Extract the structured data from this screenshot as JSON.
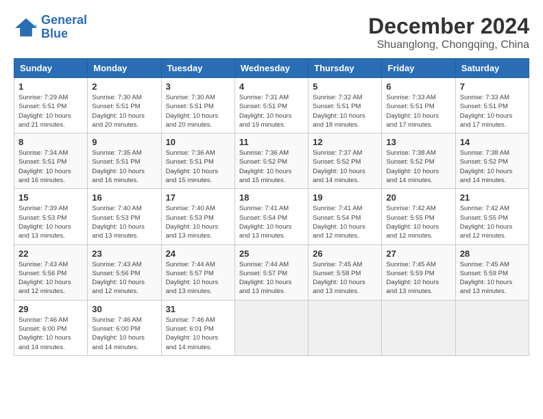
{
  "logo": {
    "line1": "General",
    "line2": "Blue"
  },
  "title": "December 2024",
  "subtitle": "Shuanglong, Chongqing, China",
  "weekdays": [
    "Sunday",
    "Monday",
    "Tuesday",
    "Wednesday",
    "Thursday",
    "Friday",
    "Saturday"
  ],
  "weeks": [
    [
      {
        "day": "1",
        "info": "Sunrise: 7:29 AM\nSunset: 5:51 PM\nDaylight: 10 hours\nand 21 minutes."
      },
      {
        "day": "2",
        "info": "Sunrise: 7:30 AM\nSunset: 5:51 PM\nDaylight: 10 hours\nand 20 minutes."
      },
      {
        "day": "3",
        "info": "Sunrise: 7:30 AM\nSunset: 5:51 PM\nDaylight: 10 hours\nand 20 minutes."
      },
      {
        "day": "4",
        "info": "Sunrise: 7:31 AM\nSunset: 5:51 PM\nDaylight: 10 hours\nand 19 minutes."
      },
      {
        "day": "5",
        "info": "Sunrise: 7:32 AM\nSunset: 5:51 PM\nDaylight: 10 hours\nand 18 minutes."
      },
      {
        "day": "6",
        "info": "Sunrise: 7:33 AM\nSunset: 5:51 PM\nDaylight: 10 hours\nand 17 minutes."
      },
      {
        "day": "7",
        "info": "Sunrise: 7:33 AM\nSunset: 5:51 PM\nDaylight: 10 hours\nand 17 minutes."
      }
    ],
    [
      {
        "day": "8",
        "info": "Sunrise: 7:34 AM\nSunset: 5:51 PM\nDaylight: 10 hours\nand 16 minutes."
      },
      {
        "day": "9",
        "info": "Sunrise: 7:35 AM\nSunset: 5:51 PM\nDaylight: 10 hours\nand 16 minutes."
      },
      {
        "day": "10",
        "info": "Sunrise: 7:36 AM\nSunset: 5:51 PM\nDaylight: 10 hours\nand 15 minutes."
      },
      {
        "day": "11",
        "info": "Sunrise: 7:36 AM\nSunset: 5:52 PM\nDaylight: 10 hours\nand 15 minutes."
      },
      {
        "day": "12",
        "info": "Sunrise: 7:37 AM\nSunset: 5:52 PM\nDaylight: 10 hours\nand 14 minutes."
      },
      {
        "day": "13",
        "info": "Sunrise: 7:38 AM\nSunset: 5:52 PM\nDaylight: 10 hours\nand 14 minutes."
      },
      {
        "day": "14",
        "info": "Sunrise: 7:38 AM\nSunset: 5:52 PM\nDaylight: 10 hours\nand 14 minutes."
      }
    ],
    [
      {
        "day": "15",
        "info": "Sunrise: 7:39 AM\nSunset: 5:53 PM\nDaylight: 10 hours\nand 13 minutes."
      },
      {
        "day": "16",
        "info": "Sunrise: 7:40 AM\nSunset: 5:53 PM\nDaylight: 10 hours\nand 13 minutes."
      },
      {
        "day": "17",
        "info": "Sunrise: 7:40 AM\nSunset: 5:53 PM\nDaylight: 10 hours\nand 13 minutes."
      },
      {
        "day": "18",
        "info": "Sunrise: 7:41 AM\nSunset: 5:54 PM\nDaylight: 10 hours\nand 13 minutes."
      },
      {
        "day": "19",
        "info": "Sunrise: 7:41 AM\nSunset: 5:54 PM\nDaylight: 10 hours\nand 12 minutes."
      },
      {
        "day": "20",
        "info": "Sunrise: 7:42 AM\nSunset: 5:55 PM\nDaylight: 10 hours\nand 12 minutes."
      },
      {
        "day": "21",
        "info": "Sunrise: 7:42 AM\nSunset: 5:55 PM\nDaylight: 10 hours\nand 12 minutes."
      }
    ],
    [
      {
        "day": "22",
        "info": "Sunrise: 7:43 AM\nSunset: 5:56 PM\nDaylight: 10 hours\nand 12 minutes."
      },
      {
        "day": "23",
        "info": "Sunrise: 7:43 AM\nSunset: 5:56 PM\nDaylight: 10 hours\nand 12 minutes."
      },
      {
        "day": "24",
        "info": "Sunrise: 7:44 AM\nSunset: 5:57 PM\nDaylight: 10 hours\nand 13 minutes."
      },
      {
        "day": "25",
        "info": "Sunrise: 7:44 AM\nSunset: 5:57 PM\nDaylight: 10 hours\nand 13 minutes."
      },
      {
        "day": "26",
        "info": "Sunrise: 7:45 AM\nSunset: 5:58 PM\nDaylight: 10 hours\nand 13 minutes."
      },
      {
        "day": "27",
        "info": "Sunrise: 7:45 AM\nSunset: 5:59 PM\nDaylight: 10 hours\nand 13 minutes."
      },
      {
        "day": "28",
        "info": "Sunrise: 7:45 AM\nSunset: 5:59 PM\nDaylight: 10 hours\nand 13 minutes."
      }
    ],
    [
      {
        "day": "29",
        "info": "Sunrise: 7:46 AM\nSunset: 6:00 PM\nDaylight: 10 hours\nand 14 minutes."
      },
      {
        "day": "30",
        "info": "Sunrise: 7:46 AM\nSunset: 6:00 PM\nDaylight: 10 hours\nand 14 minutes."
      },
      {
        "day": "31",
        "info": "Sunrise: 7:46 AM\nSunset: 6:01 PM\nDaylight: 10 hours\nand 14 minutes."
      },
      {
        "day": "",
        "info": ""
      },
      {
        "day": "",
        "info": ""
      },
      {
        "day": "",
        "info": ""
      },
      {
        "day": "",
        "info": ""
      }
    ]
  ]
}
